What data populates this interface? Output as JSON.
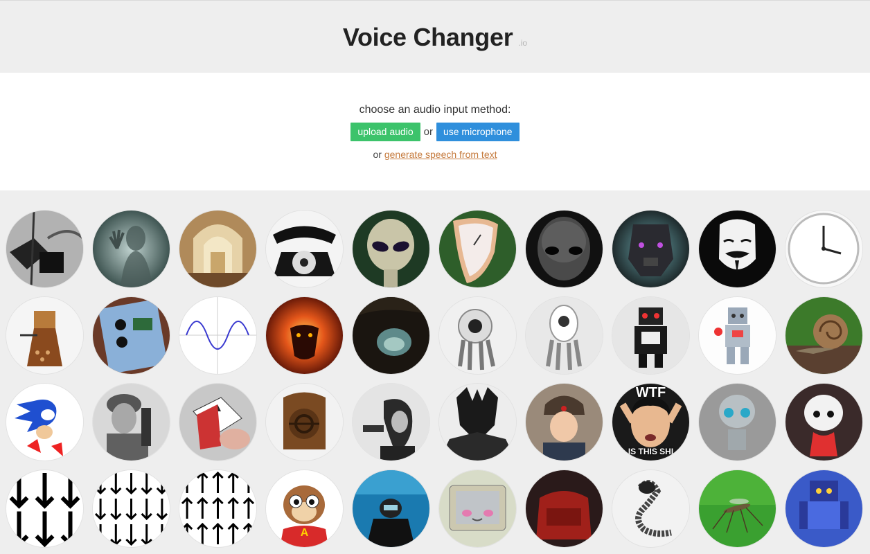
{
  "header": {
    "title": "Voice Changer",
    "suffix": ".io"
  },
  "input": {
    "prompt": "choose an audio input method:",
    "upload_label": "upload audio",
    "or_label": "or",
    "mic_label": "use microphone",
    "tts_prefix": "or",
    "tts_link": "generate speech from text"
  },
  "colors": {
    "upload_button": "#3cc36b",
    "mic_button": "#2f8fdc",
    "link": "#c57a3c"
  },
  "voices": [
    {
      "icon": "old-radio-equipment-icon"
    },
    {
      "icon": "ghost-silhouette-icon"
    },
    {
      "icon": "cathedral-interior-icon"
    },
    {
      "icon": "rotary-telephone-icon"
    },
    {
      "icon": "alien-face-icon"
    },
    {
      "icon": "melting-clock-icon"
    },
    {
      "icon": "dark-alien-face-icon"
    },
    {
      "icon": "dark-robot-icon"
    },
    {
      "icon": "anonymous-mask-icon"
    },
    {
      "icon": "reversed-clock-icon"
    },
    {
      "icon": "dalek-icon"
    },
    {
      "icon": "guitar-effects-pedal-icon"
    },
    {
      "icon": "sine-wave-icon"
    },
    {
      "icon": "fire-demon-icon"
    },
    {
      "icon": "cave-icon"
    },
    {
      "icon": "one-eyed-robot-icon"
    },
    {
      "icon": "one-eyed-robot-white-icon"
    },
    {
      "icon": "toy-robot-icon"
    },
    {
      "icon": "lego-robot-icon"
    },
    {
      "icon": "snail-icon"
    },
    {
      "icon": "sonic-hedgehog-icon"
    },
    {
      "icon": "radio-soldier-icon"
    },
    {
      "icon": "playing-cards-icon"
    },
    {
      "icon": "vintage-speaker-icon"
    },
    {
      "icon": "old-scientist-microphone-icon"
    },
    {
      "icon": "dark-lord-armor-icon"
    },
    {
      "icon": "russian-man-icon"
    },
    {
      "icon": "jackie-wtf-meme-icon",
      "text_top": "WTF",
      "text_bottom": "IS THIS SHI"
    },
    {
      "icon": "silver-robot-icon"
    },
    {
      "icon": "small-toy-robot-icon"
    },
    {
      "icon": "arrows-down-icon"
    },
    {
      "icon": "many-arrows-down-icon"
    },
    {
      "icon": "many-arrows-up-icon"
    },
    {
      "icon": "chipmunk-icon",
      "text_top": "A"
    },
    {
      "icon": "scuba-diver-icon"
    },
    {
      "icon": "retro-computer-face-icon"
    },
    {
      "icon": "red-car-interior-icon"
    },
    {
      "icon": "robot-snake-icon"
    },
    {
      "icon": "mosquito-icon"
    },
    {
      "icon": "blue-robot-icon"
    }
  ]
}
